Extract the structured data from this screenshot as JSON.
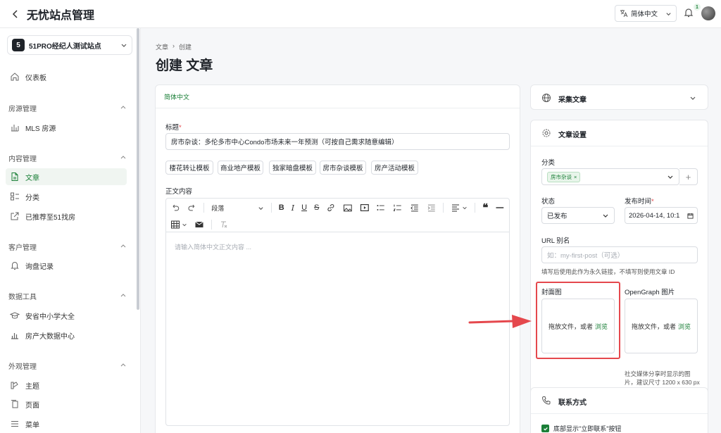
{
  "header": {
    "back_icon": "chevron-left-icon",
    "title": "无忧站点管理",
    "language": "简体中文",
    "notification_count": "1"
  },
  "sidebar": {
    "site": {
      "number": "5",
      "name": "51PRO经纪人测试站点"
    },
    "dashboard": "仪表板",
    "sections": [
      {
        "title": "房源管理",
        "items": [
          "MLS 房源"
        ]
      },
      {
        "title": "内容管理",
        "items": [
          "文章",
          "分类",
          "已推荐至51找房"
        ]
      },
      {
        "title": "客户管理",
        "items": [
          "询盘记录"
        ]
      },
      {
        "title": "数据工具",
        "items": [
          "安省中小学大全",
          "房产大数据中心"
        ]
      },
      {
        "title": "外观管理",
        "items": [
          "主题",
          "页面",
          "菜单"
        ]
      }
    ]
  },
  "breadcrumb": [
    "文章",
    "创建"
  ],
  "page_title": "创建 文章",
  "editor_card": {
    "tab": "简体中文",
    "title_label": "标题",
    "title_value": "房市杂谈：多伦多市中心Condo市场未来一年预测（可按自己需求随意编辑）",
    "templates": [
      "楼花转让模板",
      "商业地产模板",
      "独家暗盘模板",
      "房市杂谈模板",
      "房产活动模板"
    ],
    "content_label": "正文内容",
    "paragraph_select": "段落",
    "content_placeholder": "请输入简体中文正文内容 ..."
  },
  "collect_card": {
    "title": "采集文章"
  },
  "settings_card": {
    "title": "文章设置",
    "category_label": "分类",
    "category_tag": "房市杂谈",
    "status_label": "状态",
    "status_value": "已发布",
    "publish_label": "发布时间",
    "publish_value": "2026-04-14, 10:1",
    "url_label": "URL 别名",
    "url_placeholder": "如：my-first-post（可选）",
    "url_hint": "填写后使用此作为永久链接，不填写则使用文章 ID",
    "cover_label": "封面图",
    "og_label": "OpenGraph 图片",
    "drop_text": "拖放文件，或者",
    "browse": "浏览",
    "og_hint": "社交媒体分享时显示的图片，建议尺寸 1200 x 630 px"
  },
  "contact_card": {
    "title": "联系方式",
    "checkbox_label": "底部显示\"立即联系\"按钮"
  },
  "colors": {
    "accent": "#1a7f37",
    "highlight": "#e5484d"
  }
}
